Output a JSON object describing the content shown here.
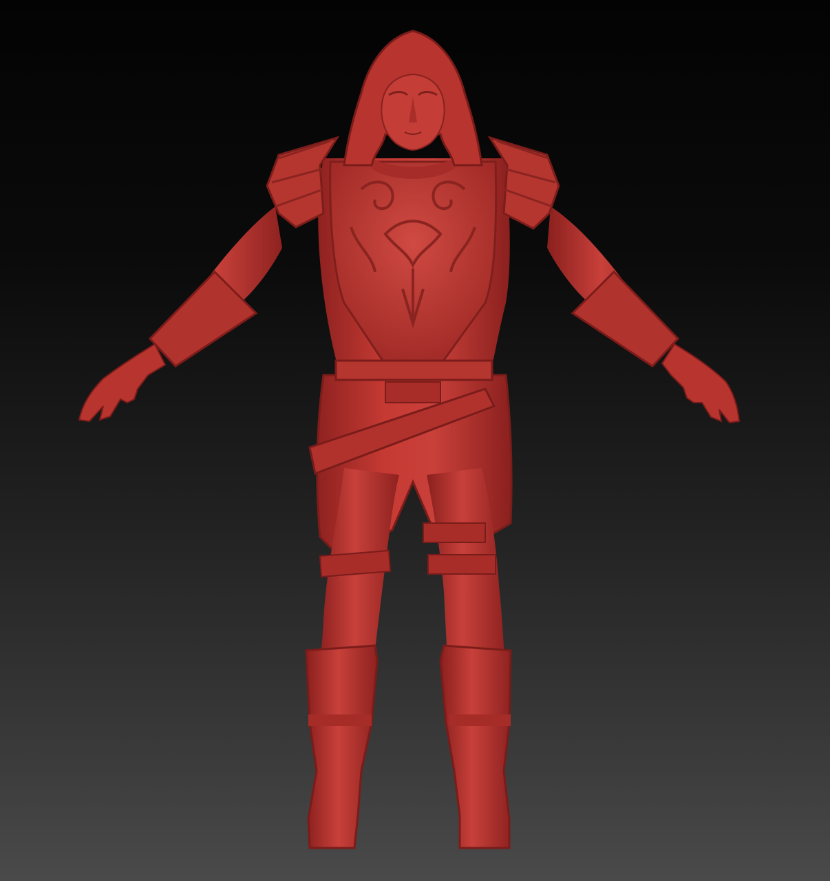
{
  "viewport": {
    "background_top": "#030303",
    "background_bottom": "#4a4a4a"
  },
  "model": {
    "material_color": "#b8302c",
    "shadow_color": "#7a1a18",
    "highlight_color": "#d8534c",
    "pose": "A-pose",
    "parts": [
      "hood",
      "face",
      "shoulder-pauldrons",
      "chest-armor",
      "bracers",
      "hands",
      "belt",
      "sash",
      "tunic-skirt",
      "thigh-straps",
      "legs",
      "boots"
    ]
  }
}
